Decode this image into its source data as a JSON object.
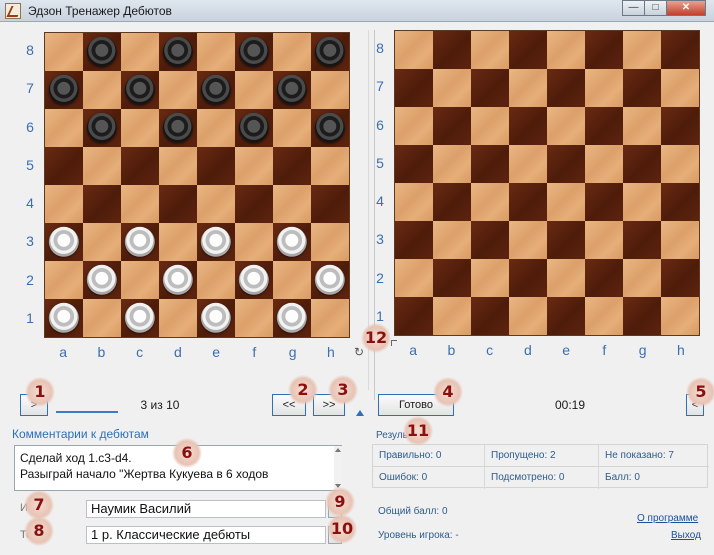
{
  "window": {
    "title": "Эдзон Тренажер Дебютов",
    "buttons": {
      "minimize": "—",
      "maximize": "□",
      "close": "✕"
    }
  },
  "boards": {
    "ranks": [
      "8",
      "7",
      "6",
      "5",
      "4",
      "3",
      "2",
      "1"
    ],
    "files": [
      "a",
      "b",
      "c",
      "d",
      "e",
      "f",
      "g",
      "h"
    ],
    "left_pieces": [
      "-b-b-b-b",
      "b-b-b-b-",
      "-b-b-b-b",
      "--------",
      "--------",
      "w-w-w-w-",
      "-w-w-w-w",
      "w-w-w-w-"
    ]
  },
  "navigation": {
    "next_label": ">",
    "counter": "3 из 10",
    "back_label": "<<",
    "forward_label": ">>"
  },
  "play": {
    "done_label": "Готово",
    "timer": "00:19",
    "collapse_label": "<"
  },
  "badges": [
    "1",
    "2",
    "3",
    "4",
    "5",
    "6",
    "7",
    "8",
    "9",
    "10",
    "11",
    "12"
  ],
  "comments": {
    "title": "Комментарии к дебютам",
    "line1": "Сделай ход 1.c3-d4.",
    "line2": "Разыграй начало \"Жертва Кукуева  в  6  ходов"
  },
  "player": {
    "label": "Игрок",
    "value": "Наумик Василий"
  },
  "test": {
    "label": "Тест",
    "value": "1 р.  Классические дебюты"
  },
  "results": {
    "title": "Результаты",
    "correct": "Правильно: 0",
    "skipped": "Пропущено: 2",
    "not_shown": "Не показано: 7",
    "errors": "Ошибок: 0",
    "peeked": "Подсмотрено: 0",
    "score": "Балл: 0",
    "total_score": "Общий балл: 0",
    "player_level": "Уровень игрока: -"
  },
  "links": {
    "about": "О программе",
    "exit": "Выход"
  }
}
